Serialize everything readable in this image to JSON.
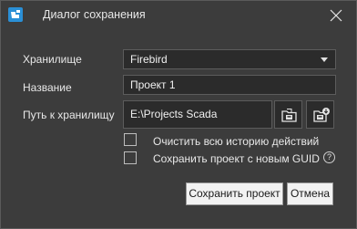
{
  "window": {
    "title": "Диалог сохранения",
    "app_icon": "app-logo-icon",
    "close_icon": "close-icon"
  },
  "form": {
    "storage": {
      "label": "Хранилище",
      "value": "Firebird"
    },
    "name": {
      "label": "Название",
      "value": "Проект 1"
    },
    "path": {
      "label": "Путь к хранилищу",
      "value": "E:\\Projects Scada",
      "browse_icon": "folder-icon",
      "network_icon": "folder-network-icon"
    },
    "clear_history": {
      "label": "Очистить всю историю действий",
      "checked": false
    },
    "save_new_guid": {
      "label": "Сохранить проект с новым GUID",
      "checked": false,
      "help": "?"
    }
  },
  "buttons": {
    "save": "Сохранить проект",
    "cancel": "Отмена"
  }
}
